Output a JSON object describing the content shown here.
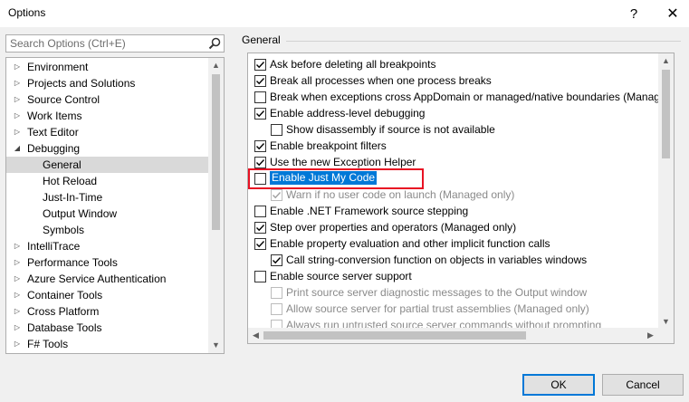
{
  "window": {
    "title": "Options",
    "help_glyph": "?",
    "close_glyph": "✕"
  },
  "search": {
    "placeholder": "Search Options (Ctrl+E)",
    "icon": "search-icon"
  },
  "tree": {
    "items": [
      {
        "label": "Environment",
        "state": "collapsed",
        "level": 0
      },
      {
        "label": "Projects and Solutions",
        "state": "collapsed",
        "level": 0
      },
      {
        "label": "Source Control",
        "state": "collapsed",
        "level": 0
      },
      {
        "label": "Work Items",
        "state": "collapsed",
        "level": 0
      },
      {
        "label": "Text Editor",
        "state": "collapsed",
        "level": 0
      },
      {
        "label": "Debugging",
        "state": "expanded",
        "level": 0
      },
      {
        "label": "General",
        "state": "leaf",
        "level": 1,
        "selected": true
      },
      {
        "label": "Hot Reload",
        "state": "leaf",
        "level": 1
      },
      {
        "label": "Just-In-Time",
        "state": "leaf",
        "level": 1
      },
      {
        "label": "Output Window",
        "state": "leaf",
        "level": 1
      },
      {
        "label": "Symbols",
        "state": "leaf",
        "level": 1
      },
      {
        "label": "IntelliTrace",
        "state": "collapsed",
        "level": 0
      },
      {
        "label": "Performance Tools",
        "state": "collapsed",
        "level": 0
      },
      {
        "label": "Azure Service Authentication",
        "state": "collapsed",
        "level": 0
      },
      {
        "label": "Container Tools",
        "state": "collapsed",
        "level": 0
      },
      {
        "label": "Cross Platform",
        "state": "collapsed",
        "level": 0
      },
      {
        "label": "Database Tools",
        "state": "collapsed",
        "level": 0
      },
      {
        "label": "F# Tools",
        "state": "collapsed",
        "level": 0
      }
    ]
  },
  "section": {
    "title": "General"
  },
  "options": [
    {
      "label": "Ask before deleting all breakpoints",
      "checked": true,
      "indent": 0
    },
    {
      "label": "Break all processes when one process breaks",
      "checked": true,
      "indent": 0
    },
    {
      "label": "Break when exceptions cross AppDomain or managed/native boundaries (Manag",
      "checked": false,
      "indent": 0
    },
    {
      "label": "Enable address-level debugging",
      "checked": true,
      "indent": 0
    },
    {
      "label": "Show disassembly if source is not available",
      "checked": false,
      "indent": 1
    },
    {
      "label": "Enable breakpoint filters",
      "checked": true,
      "indent": 0
    },
    {
      "label": "Use the new Exception Helper",
      "checked": true,
      "indent": 0
    },
    {
      "label": "Enable Just My Code",
      "checked": false,
      "indent": 0,
      "highlight": true
    },
    {
      "label": "Warn if no user code on launch (Managed only)",
      "checked": true,
      "indent": 1,
      "disabled": true
    },
    {
      "label": "Enable .NET Framework source stepping",
      "checked": false,
      "indent": 0
    },
    {
      "label": "Step over properties and operators (Managed only)",
      "checked": true,
      "indent": 0
    },
    {
      "label": "Enable property evaluation and other implicit function calls",
      "checked": true,
      "indent": 0
    },
    {
      "label": "Call string-conversion function on objects in variables windows",
      "checked": true,
      "indent": 1
    },
    {
      "label": "Enable source server support",
      "checked": false,
      "indent": 0
    },
    {
      "label": "Print source server diagnostic messages to the Output window",
      "checked": false,
      "indent": 1,
      "disabled": true
    },
    {
      "label": "Allow source server for partial trust assemblies (Managed only)",
      "checked": false,
      "indent": 1,
      "disabled": true
    },
    {
      "label": "Always run untrusted source server commands without prompting",
      "checked": false,
      "indent": 1,
      "disabled": true
    }
  ],
  "buttons": {
    "ok": "OK",
    "cancel": "Cancel"
  },
  "colors": {
    "highlight": "#0078d7",
    "focus_box": "#e81123"
  }
}
